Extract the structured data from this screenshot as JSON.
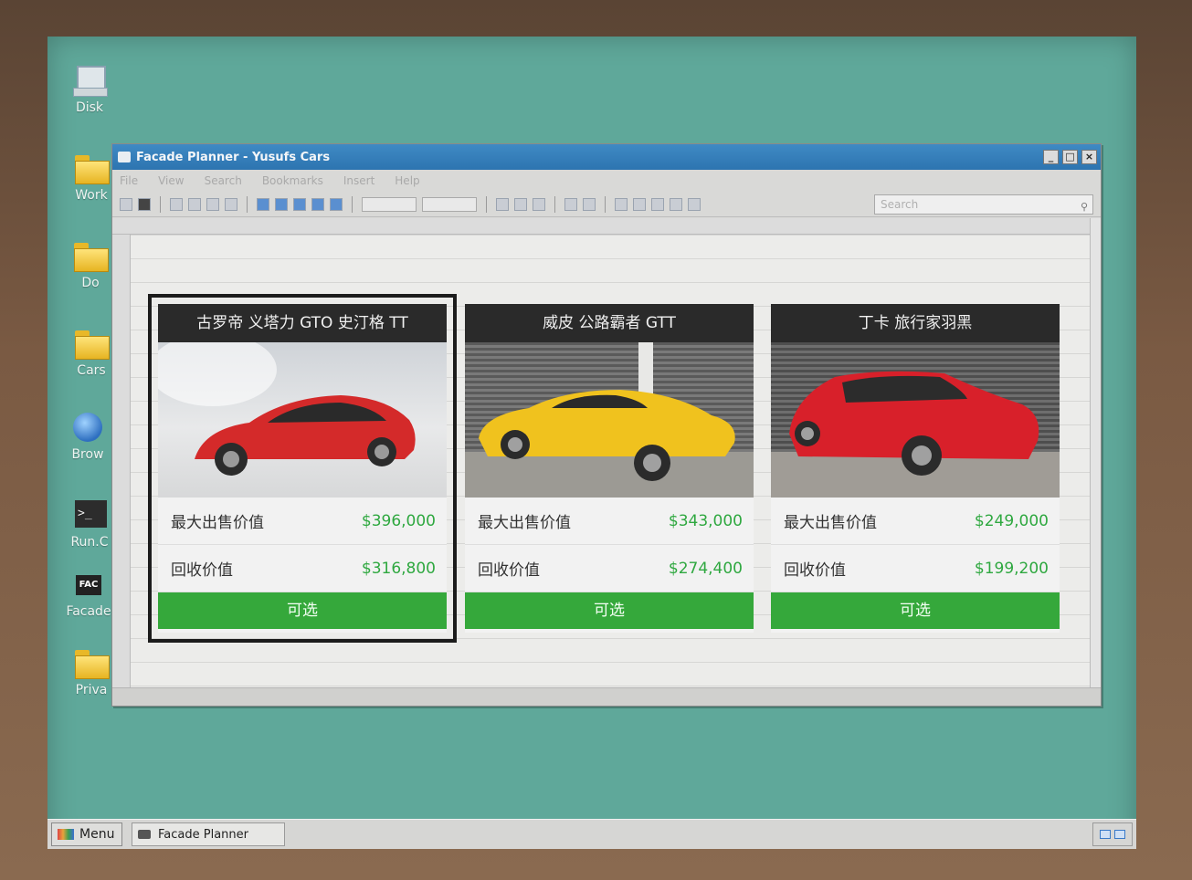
{
  "desktop": {
    "icons": [
      {
        "label": "Disk"
      },
      {
        "label": "Work"
      },
      {
        "label": "Do"
      },
      {
        "label": "Cars"
      },
      {
        "label": "Brow"
      },
      {
        "label": "Run.C"
      },
      {
        "label": "Facade"
      },
      {
        "label": "Priva"
      }
    ]
  },
  "window": {
    "title": "Facade Planner - Yusufs Cars",
    "menu": [
      "File",
      "View",
      "Search",
      "Bookmarks",
      "Insert",
      "Help"
    ],
    "search_placeholder": "Search"
  },
  "cards": [
    {
      "title": "古罗帝 义塔力 GTO 史汀格 TT",
      "car_color": "#d42a2a",
      "max_sale_label": "最大出售价值",
      "max_sale_value": "$396,000",
      "trade_label": "回收价值",
      "trade_value": "$316,800",
      "button": "可选",
      "selected": true
    },
    {
      "title": "威皮 公路霸者 GTT",
      "car_color": "#f0c21e",
      "max_sale_label": "最大出售价值",
      "max_sale_value": "$343,000",
      "trade_label": "回收价值",
      "trade_value": "$274,400",
      "button": "可选",
      "selected": false
    },
    {
      "title": "丁卡 旅行家羽黑",
      "car_color": "#d8202a",
      "max_sale_label": "最大出售价值",
      "max_sale_value": "$249,000",
      "trade_label": "回收价值",
      "trade_value": "$199,200",
      "button": "可选",
      "selected": false
    }
  ],
  "taskbar": {
    "menu_label": "Menu",
    "task_label": "Facade Planner"
  }
}
